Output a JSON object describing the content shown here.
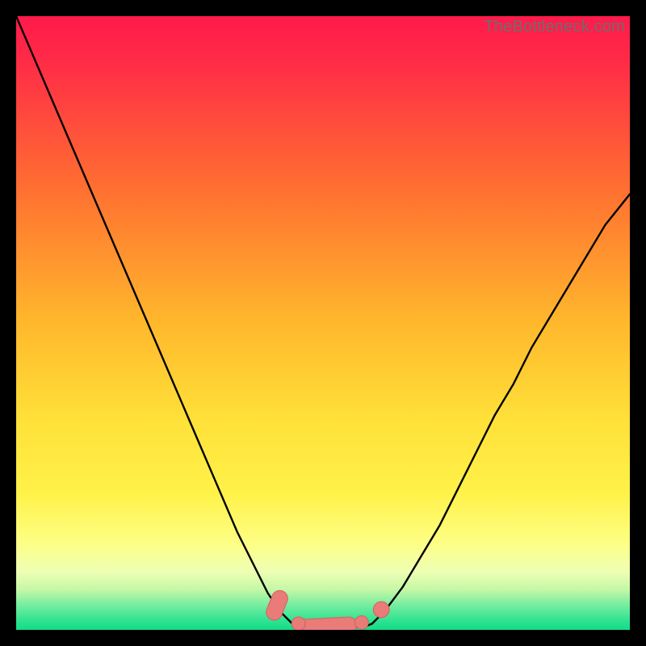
{
  "watermark": "TheBottleneck.com",
  "colors": {
    "bg": "#000000",
    "grad_top": "#ff1a4b",
    "grad_mid1": "#ff7a2e",
    "grad_mid2": "#ffd531",
    "grad_mid3": "#fff24a",
    "grad_low": "#f8ffa8",
    "grad_green1": "#baf7a0",
    "grad_green2": "#4de88c",
    "grad_bottom": "#12dd87",
    "curve": "#000000",
    "marker_fill": "#e97b78",
    "marker_stroke": "#d85f5c"
  },
  "chart_data": {
    "type": "line",
    "title": "",
    "xlabel": "",
    "ylabel": "",
    "xlim": [
      0,
      100
    ],
    "ylim": [
      0,
      100
    ],
    "grid": false,
    "legend": false,
    "series": [
      {
        "name": "left-curve",
        "x": [
          0,
          3,
          6,
          9,
          12,
          15,
          18,
          21,
          24,
          27,
          30,
          33,
          36,
          39,
          41,
          43,
          45
        ],
        "y": [
          100,
          93,
          86,
          79,
          72,
          65,
          58,
          51,
          44,
          37,
          30,
          23,
          16,
          10,
          6,
          3,
          1
        ]
      },
      {
        "name": "right-curve",
        "x": [
          58,
          60,
          63,
          66,
          69,
          72,
          75,
          78,
          81,
          84,
          87,
          90,
          93,
          96,
          100
        ],
        "y": [
          1,
          3,
          7,
          12,
          17,
          23,
          29,
          35,
          40,
          46,
          51,
          56,
          61,
          66,
          71
        ]
      },
      {
        "name": "valley-floor",
        "x": [
          45,
          47,
          49,
          51,
          53,
          55,
          57,
          58
        ],
        "y": [
          1,
          0.5,
          0.3,
          0.25,
          0.3,
          0.4,
          0.6,
          1
        ]
      }
    ],
    "markers": [
      {
        "shape": "capsule",
        "x": 42.5,
        "y": 4,
        "len": 5,
        "angle": 68
      },
      {
        "shape": "capsule",
        "x": 50.5,
        "y": 0.6,
        "len": 10,
        "angle": 3
      },
      {
        "shape": "circle",
        "x": 56.3,
        "y": 1.2,
        "r": 1.1
      },
      {
        "shape": "circle",
        "x": 59.5,
        "y": 3.3,
        "r": 1.3
      },
      {
        "shape": "circle",
        "x": 46.0,
        "y": 1.0,
        "r": 1.1
      }
    ],
    "annotations": []
  }
}
